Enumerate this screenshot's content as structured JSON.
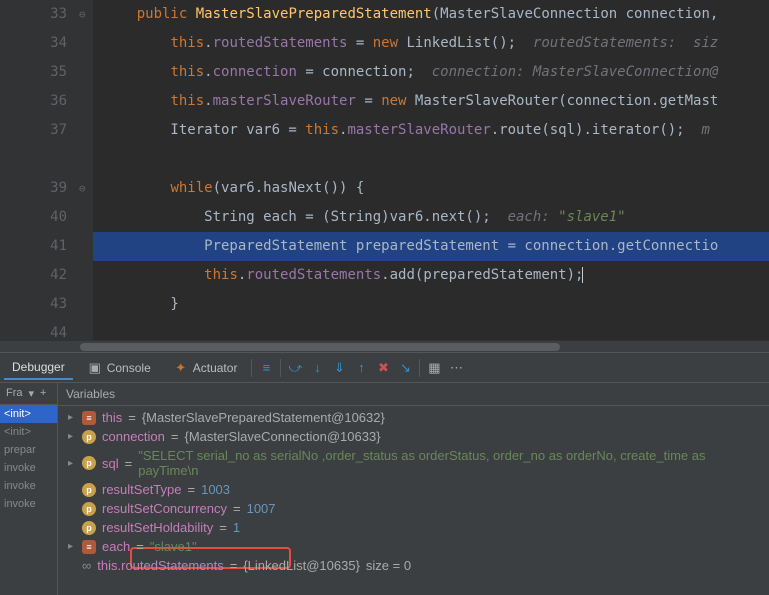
{
  "editor": {
    "lines": [
      {
        "num": "33",
        "at": "@",
        "html": "    <span class='kw'>public</span> <span class='mth'>MasterSlavePreparedStatement</span>(MasterSlaveConnection <span class='id'>connection</span>,"
      },
      {
        "num": "34",
        "html": "        <span class='kw'>this</span>.<span class='fld'>routedStatements</span> = <span class='kw'>new</span> LinkedList();  <span class='param'>routedStatements:  siz</span>"
      },
      {
        "num": "35",
        "html": "        <span class='kw'>this</span>.<span class='fld'>connection</span> = connection;  <span class='param'>connection: MasterSlaveConnection@</span>"
      },
      {
        "num": "36",
        "html": "        <span class='kw'>this</span>.<span class='fld'>masterSlaveRouter</span> = <span class='kw'>new</span> MasterSlaveRouter(connection.getMast"
      },
      {
        "num": "37",
        "html": "        Iterator var6 = <span class='kw'>this</span>.<span class='fld'>masterSlaveRouter</span>.route(sql).iterator();  <span class='param'>m</span>"
      },
      {
        "num": "",
        "html": ""
      },
      {
        "num": "39",
        "html": "        <span class='kw'>while</span>(var6.hasNext()) {"
      },
      {
        "num": "40",
        "html": "            String each = (String)var6.next();  <span class='param'>each: </span><span class='paramv'>\"slave1\"</span>"
      },
      {
        "num": "41",
        "bp": true,
        "hl": true,
        "html": "            PreparedStatement preparedStatement = connection.getConnectio"
      },
      {
        "num": "42",
        "html": "            <span class='kw'>this</span>.<span class='fld'>routedStatements</span>.add(preparedStatement);<span class='caret'></span>"
      },
      {
        "num": "43",
        "html": "        }"
      },
      {
        "num": "44",
        "html": ""
      }
    ]
  },
  "debugger": {
    "tabs": {
      "debugger": "Debugger",
      "console": "Console",
      "actuator": "Actuator"
    },
    "frames_label": "Fra",
    "variables_label": "Variables",
    "stack": [
      {
        "label": "<init>",
        "cur": true
      },
      {
        "label": "<init>"
      },
      {
        "label": "prepar"
      },
      {
        "label": "invoke"
      },
      {
        "label": "invoke"
      },
      {
        "label": "invoke"
      }
    ],
    "vars": [
      {
        "arrow": true,
        "ico": "obj",
        "name": "this",
        "val": "{MasterSlavePreparedStatement@10632}"
      },
      {
        "arrow": true,
        "ico": "p",
        "name": "connection",
        "val": "{MasterSlaveConnection@10633}"
      },
      {
        "arrow": true,
        "ico": "p",
        "name": "sql",
        "str": "\"SELECT serial_no as serialNo ,order_status as orderStatus, order_no as orderNo, create_time as payTime\\n"
      },
      {
        "ico": "p",
        "name": "resultSetType",
        "num": "1003"
      },
      {
        "ico": "p",
        "name": "resultSetConcurrency",
        "num": "1007"
      },
      {
        "ico": "p",
        "name": "resultSetHoldability",
        "num": "1"
      },
      {
        "arrow": true,
        "ico": "obj",
        "name": "each",
        "str": "\"slave1\""
      },
      {
        "ico": "link",
        "name": "this.routedStatements",
        "val": "{LinkedList@10635}",
        "extra": " size = 0"
      }
    ]
  }
}
